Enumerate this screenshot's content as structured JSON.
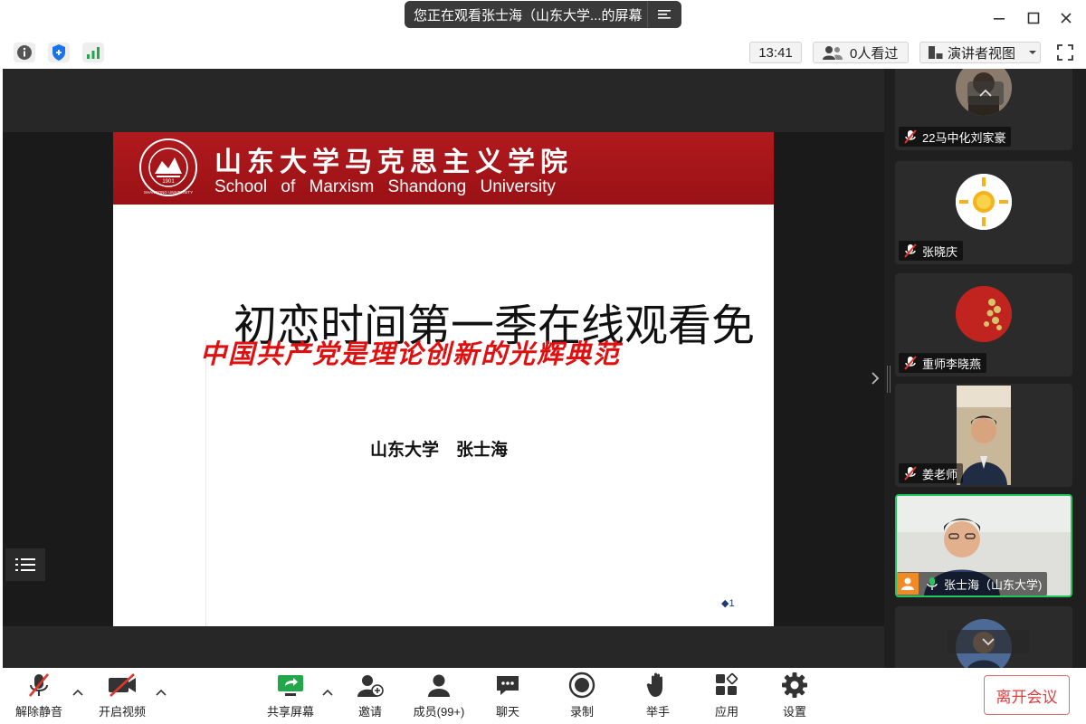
{
  "titlebar": {
    "share_notice": "您正在观看张士海（山东大学...的屏幕"
  },
  "infobar": {
    "clock": "13:41",
    "viewers": "0人看过",
    "view_mode": "演讲者视图"
  },
  "slide": {
    "banner_cn": "山东大学马克思主义学院",
    "banner_en": "School of Marxism Shandong University",
    "seal_text": "SHANDONG UNIVERSITY",
    "seal_year": "1901",
    "title": "初恋时间第一季在线观看免",
    "subtitle": "中国共产党是理论创新的光辉典范",
    "author": "山东大学　张士海",
    "page": "1"
  },
  "participants": [
    {
      "name": "22马中化刘家豪",
      "mic": "muted"
    },
    {
      "name": "张晓庆",
      "mic": "muted"
    },
    {
      "name": "重师李晓燕",
      "mic": "muted"
    },
    {
      "name": "姜老师",
      "mic": "muted"
    },
    {
      "name": "张士海（山东大学)",
      "mic": "on",
      "speaking": true
    },
    {
      "name": "",
      "mic": "muted"
    }
  ],
  "toolbar": {
    "unmute": "解除静音",
    "start_video": "开启视频",
    "share_screen": "共享屏幕",
    "invite": "邀请",
    "members": "成员(99+)",
    "chat": "聊天",
    "record": "录制",
    "raise_hand": "举手",
    "apps": "应用",
    "settings": "设置",
    "leave": "离开会议"
  },
  "colors": {
    "banner_red": "#a3151a",
    "subtitle_red": "#e01010",
    "active_green": "#22c55e",
    "leave_red": "#e03b3b",
    "mute_red": "#e0362c"
  }
}
